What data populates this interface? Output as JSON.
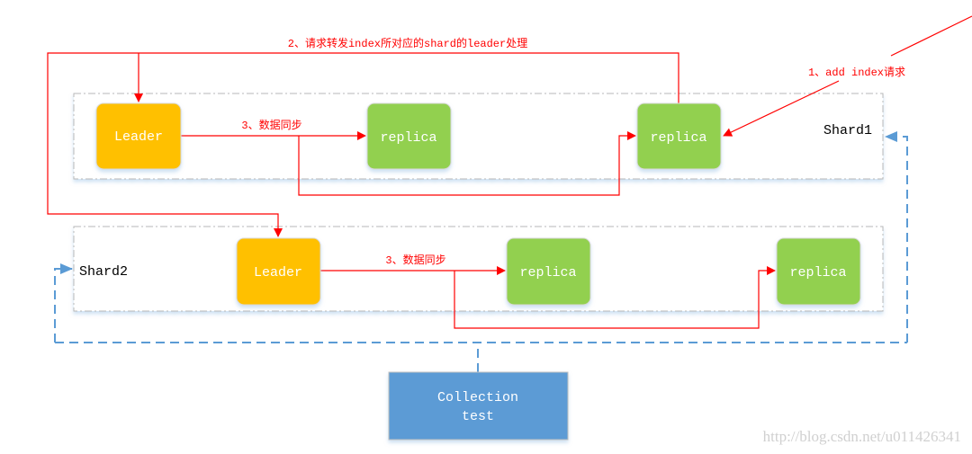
{
  "diagram": {
    "shards": [
      {
        "label": "Shard1",
        "nodes": [
          "Leader",
          "replica",
          "replica"
        ]
      },
      {
        "label": "Shard2",
        "nodes": [
          "Leader",
          "replica",
          "replica"
        ]
      }
    ],
    "collection": {
      "line1": "Collection",
      "line2": "test"
    },
    "steps": {
      "step1": "1、add index请求",
      "step2": "2、请求转发index所对应的shard的leader处理",
      "step3a": "3、数据同步",
      "step3b": "3、数据同步"
    },
    "watermark": "http://blog.csdn.net/u011426341",
    "colors": {
      "leader": "#FFC000",
      "replica": "#92D050",
      "collection": "#5B9BD5",
      "request_arrows": "#FF0000",
      "shard_links": "#5B9BD5"
    }
  }
}
